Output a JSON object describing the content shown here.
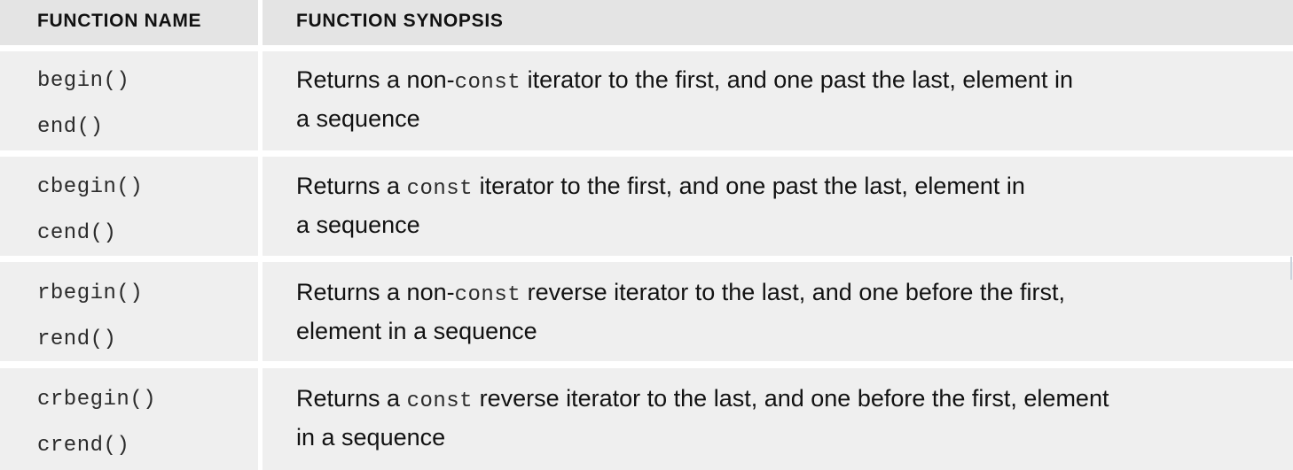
{
  "header": {
    "col1": "FUNCTION NAME",
    "col2": "FUNCTION SYNOPSIS"
  },
  "rows": [
    {
      "names": [
        "begin()",
        "end()"
      ],
      "synopsis": {
        "pre": "Returns a non-",
        "code": "const",
        "line1_post": " iterator to the first, and one past the last, element in",
        "line2": "a sequence"
      }
    },
    {
      "names": [
        "cbegin()",
        "cend()"
      ],
      "synopsis": {
        "pre": "Returns a ",
        "code": "const",
        "line1_post": " iterator to the first, and one past the last, element in",
        "line2": "a sequence"
      }
    },
    {
      "names": [
        "rbegin()",
        "rend()"
      ],
      "synopsis": {
        "pre": "Returns a non-",
        "code": "const",
        "line1_post": " reverse iterator to the last, and one before the first,",
        "line2": "element in a sequence"
      }
    },
    {
      "names": [
        "crbegin()",
        "crend()"
      ],
      "synopsis": {
        "pre": "Returns a ",
        "code": "const",
        "line1_post": " reverse iterator to the last, and one before the first, element",
        "line2": "in a sequence"
      }
    }
  ]
}
